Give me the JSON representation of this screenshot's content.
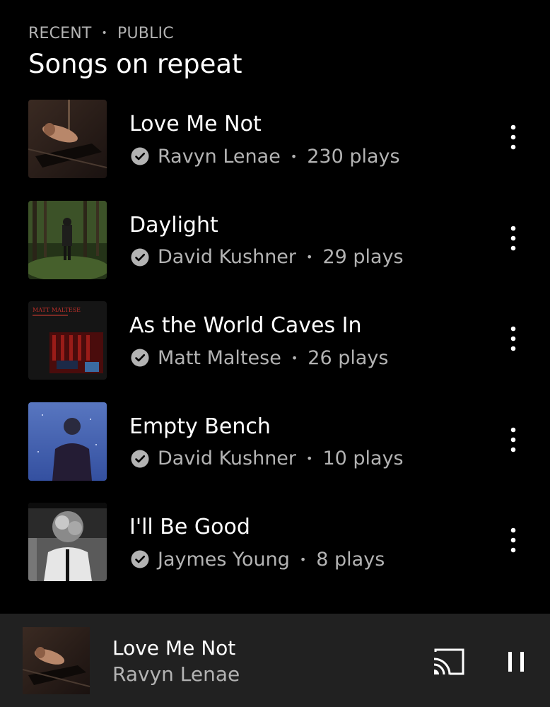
{
  "section": {
    "kicker_left": "RECENT",
    "kicker_sep": "•",
    "kicker_right": "PUBLIC",
    "title": "Songs on repeat"
  },
  "songs": [
    {
      "title": "Love Me Not",
      "artist": "Ravyn Lenae",
      "plays": "230 plays",
      "sep": "•",
      "playing": true
    },
    {
      "title": "Daylight",
      "artist": "David Kushner",
      "plays": "29 plays",
      "sep": "•"
    },
    {
      "title": "As the World Caves In",
      "artist": "Matt Maltese",
      "plays": "26 plays",
      "sep": "•",
      "cover_text": "MATT MALTESE"
    },
    {
      "title": "Empty Bench",
      "artist": "David Kushner",
      "plays": "10 plays",
      "sep": "•"
    },
    {
      "title": "I'll Be Good",
      "artist": "Jaymes Young",
      "plays": "8 plays",
      "sep": "•"
    }
  ],
  "now_playing": {
    "title": "Love Me Not",
    "artist": "Ravyn Lenae"
  },
  "icons": {
    "verified": "check-circle-icon",
    "more": "more-vertical-icon",
    "equalizer": "equalizer-icon",
    "cast": "cast-icon",
    "pause": "pause-icon"
  },
  "colors": {
    "background": "#000000",
    "secondary_text": "#b3b3b3",
    "mini_player_bg": "#212121"
  }
}
